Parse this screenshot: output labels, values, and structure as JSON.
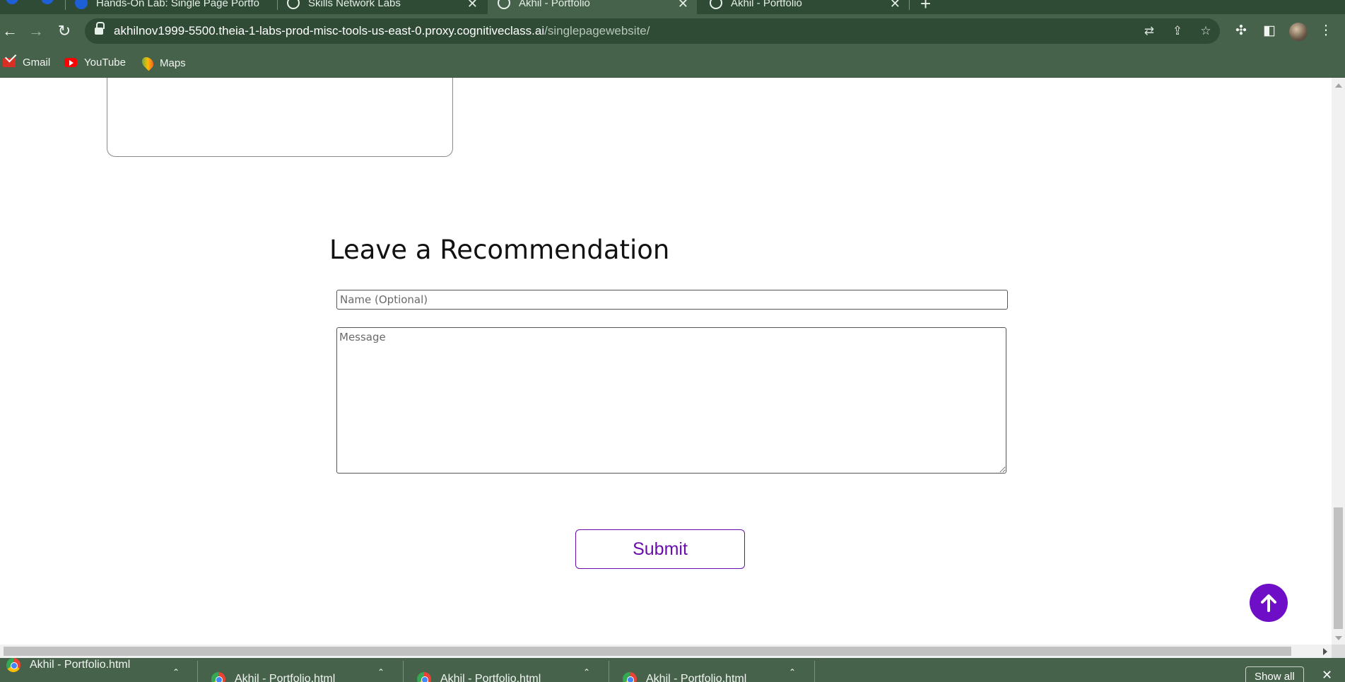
{
  "browser": {
    "tabs": [
      {
        "label": "Hands-On Lab: Single Page Portfo",
        "active": false
      },
      {
        "label": "Skills Network Labs",
        "active": false
      },
      {
        "label": "Akhil - Portfolio",
        "active": true
      },
      {
        "label": "Akhil - Portfolio",
        "active": false
      }
    ],
    "new_tab_label": "+",
    "url_host": "akhilnov1999-5500.theia-1-labs-prod-misc-tools-us-east-0.proxy.cognitiveclass.ai",
    "url_path": "/singlepagewebsite/",
    "bookmarks": [
      {
        "label": "Gmail",
        "icon": "gmail-icon"
      },
      {
        "label": "YouTube",
        "icon": "youtube-icon"
      },
      {
        "label": "Maps",
        "icon": "maps-icon"
      }
    ]
  },
  "page": {
    "section_title": "Leave a Recommendation",
    "name_placeholder": "Name (Optional)",
    "message_placeholder": "Message",
    "submit_label": "Submit",
    "accent_color": "#6a0dad"
  },
  "downloads": {
    "items": [
      {
        "label": "Akhil - Portfolio.html"
      },
      {
        "label": "Akhil - Portfolio.html"
      },
      {
        "label": "Akhil - Portfolio.html"
      },
      {
        "label": "Akhil - Portfolio.html"
      }
    ],
    "show_all_label": "Show all"
  }
}
